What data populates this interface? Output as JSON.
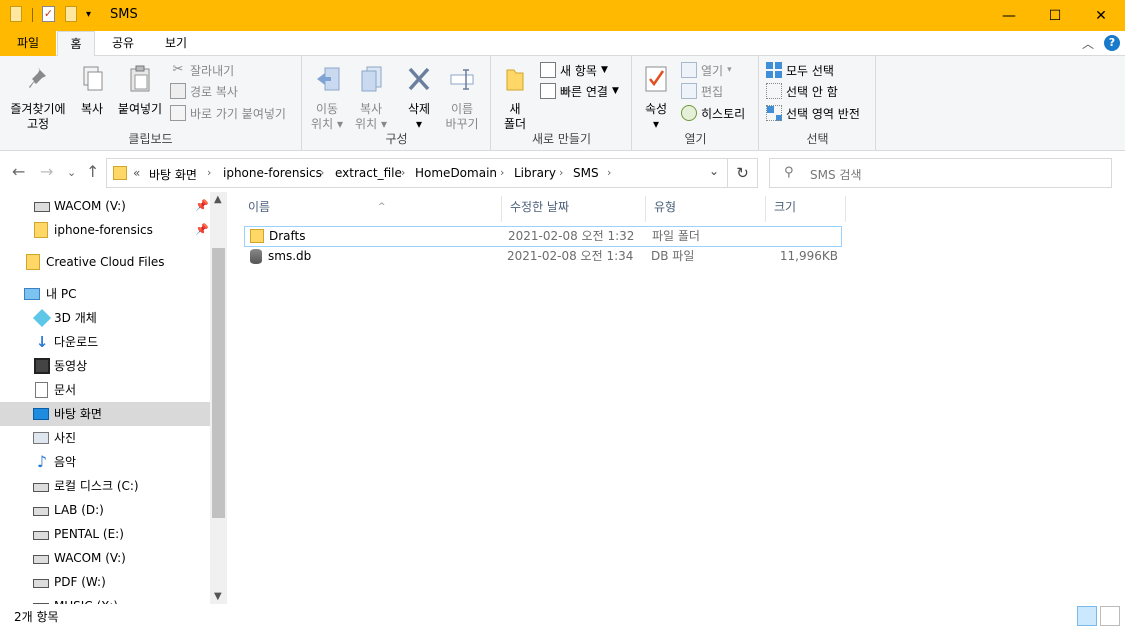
{
  "window": {
    "title": "SMS",
    "minimize": "—",
    "maximize": "☐",
    "close": "✕"
  },
  "ribbon_tabs": [
    "파일",
    "홈",
    "공유",
    "보기"
  ],
  "ribbon": {
    "clipboard": {
      "pin_label_1": "즐겨찾기에",
      "pin_label_2": "고정",
      "copy": "복사",
      "paste": "붙여넣기",
      "cut": "잘라내기",
      "copy_path": "경로 복사",
      "paste_shortcut": "바로 가기 붙여넣기",
      "group_label": "클립보드"
    },
    "organize": {
      "move_1": "이동",
      "move_2": "위치",
      "copyto_1": "복사",
      "copyto_2": "위치",
      "delete": "삭제",
      "rename_1": "이름",
      "rename_2": "바꾸기",
      "group_label": "구성"
    },
    "new": {
      "new_folder_1": "새",
      "new_folder_2": "폴더",
      "new_item": "새 항목",
      "easy_access": "빠른 연결",
      "group_label": "새로 만들기"
    },
    "open": {
      "properties": "속성",
      "open": "열기",
      "edit": "편집",
      "history": "히스토리",
      "group_label": "열기"
    },
    "select": {
      "select_all": "모두 선택",
      "select_none": "선택 안 함",
      "invert": "선택 영역 반전",
      "group_label": "선택"
    }
  },
  "address": {
    "overflow": "«",
    "crumbs": [
      "바탕 화면",
      "iphone-forensics",
      "extract_file",
      "HomeDomain",
      "Library",
      "SMS"
    ],
    "search_placeholder": "SMS 검색"
  },
  "nav": {
    "items": [
      {
        "label": "WACOM (V:)",
        "icon": "drive-icon",
        "pinned": true
      },
      {
        "label": "iphone-forensics",
        "icon": "folder-icon",
        "pinned": true
      },
      {
        "label": "Creative Cloud Files",
        "icon": "creative-cloud-icon"
      },
      {
        "label": "내 PC",
        "icon": "pc-icon"
      },
      {
        "label": "3D 개체",
        "icon": "3d-objects-icon"
      },
      {
        "label": "다운로드",
        "icon": "download-icon"
      },
      {
        "label": "동영상",
        "icon": "video-icon"
      },
      {
        "label": "문서",
        "icon": "document-icon"
      },
      {
        "label": "바탕 화면",
        "icon": "desktop-icon",
        "selected": true
      },
      {
        "label": "사진",
        "icon": "pictures-icon"
      },
      {
        "label": "음악",
        "icon": "music-icon"
      },
      {
        "label": "로컬 디스크 (C:)",
        "icon": "local-disk-icon"
      },
      {
        "label": "LAB (D:)",
        "icon": "drive-icon"
      },
      {
        "label": "PENTAL (E:)",
        "icon": "drive-icon"
      },
      {
        "label": "WACOM (V:)",
        "icon": "drive-icon"
      },
      {
        "label": "PDF (W:)",
        "icon": "drive-icon"
      },
      {
        "label": "MUSIC (X:)",
        "icon": "drive-icon"
      }
    ]
  },
  "files": {
    "columns": [
      "이름",
      "수정한 날짜",
      "유형",
      "크기"
    ],
    "rows": [
      {
        "name": "Drafts",
        "modified": "2021-02-08 오전 1:32",
        "type": "파일 폴더",
        "size": "",
        "icon": "folder-icon",
        "selected": true
      },
      {
        "name": "sms.db",
        "modified": "2021-02-08 오전 1:34",
        "type": "DB 파일",
        "size": "11,996KB",
        "icon": "database-icon"
      }
    ]
  },
  "status": {
    "count": "2개 항목"
  },
  "colors": {
    "titlebar": "#ffb900",
    "selection": "#cce8ff",
    "accent": "#1979ca"
  }
}
